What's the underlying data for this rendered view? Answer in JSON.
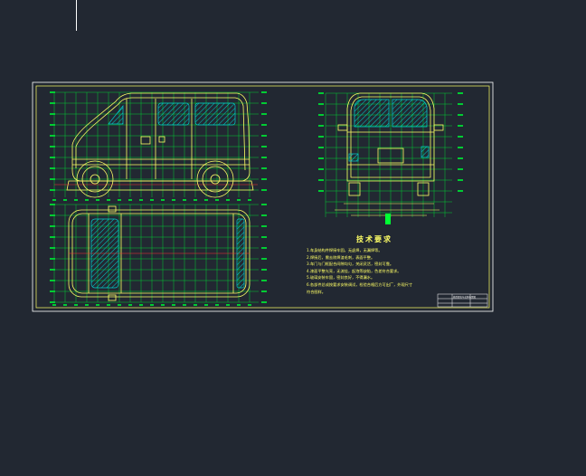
{
  "colors": {
    "background": "#222832",
    "border": "#ffffff",
    "grid": "#00cc33",
    "outline": "#ffff66",
    "glass": "#00cccc",
    "tick": "#ff3333"
  },
  "notes": {
    "title": "技术要求",
    "lines": [
      "1.车身结构件焊接牢固，无虚焊，无漏焊等。",
      "2.焊接后，需去除焊渣毛刺，表面平整。",
      "3.车门与门框配合间隙均匀，关闭灵活，密封可靠。",
      "4.漆面平整光亮，无流挂，起泡等缺陷，色差符合要求。",
      "5.玻璃安装牢固，密封良好，不得漏水。",
      "6.各部件总成按要求安装调试，检验合格后方可出厂，外观尺寸",
      "   符合图样。"
    ]
  },
  "title_block": {
    "label": "微型面包车总体布置图"
  }
}
